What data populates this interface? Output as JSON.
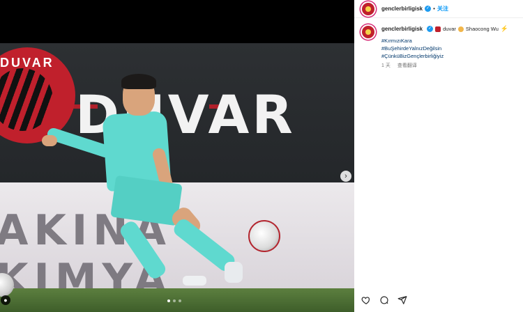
{
  "post": {
    "author": "genclerbirligisk",
    "follow_label": "关注",
    "separator": "•",
    "caption_suffix": "duvar",
    "tagged_user": "Shaocong Wu",
    "hashtags": [
      "#KırmızıKara",
      "#BuŞehirdeYalnızDeğilsin",
      "#ÇünküBizGençlerbirliğiyiz"
    ],
    "time_ago": "1 天",
    "translate_label": "查看翻译"
  },
  "media": {
    "board_text": "DUVAR",
    "logo_text": "DUVAR",
    "ad_text": "AKINA KIMYA",
    "carousel_dots": 3,
    "active_dot": 1
  },
  "icons": {
    "like": "heart-icon",
    "comment": "comment-icon",
    "share": "share-icon",
    "next": "chevron-right-icon",
    "user_tag": "user-tag-icon",
    "verified": "verified-badge-icon"
  },
  "colors": {
    "accent": "#0095f6",
    "hashtag": "#00376b",
    "verified": "#1d9bf0"
  }
}
